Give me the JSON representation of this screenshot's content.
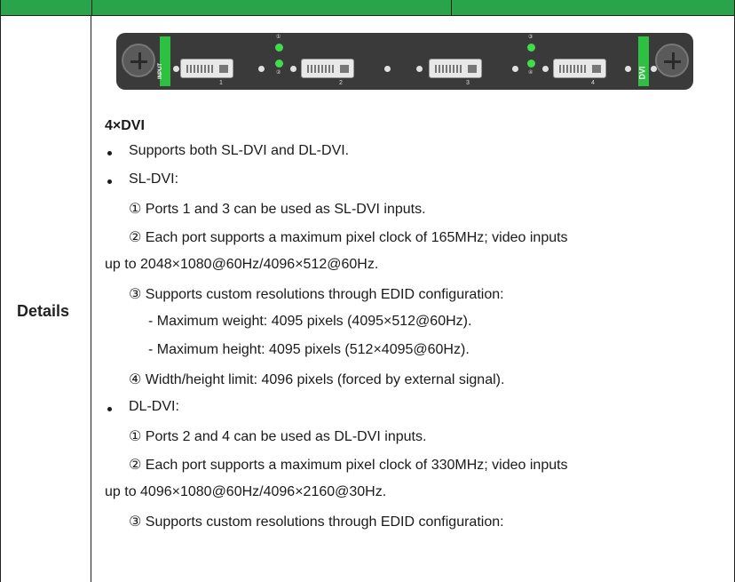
{
  "row_label": "Details",
  "panel": {
    "left_strip": "INPUT",
    "right_strip": "DVI",
    "port_numbers": [
      "1",
      "2",
      "3",
      "4"
    ],
    "led_labels": [
      "①",
      "②",
      "③",
      "④"
    ]
  },
  "heading": "4×DVI",
  "lines": {
    "b1": "Supports both SL-DVI and DL-DVI.",
    "b2": "SL-DVI:",
    "sl1": "① Ports 1 and 3 can be used as SL-DVI inputs.",
    "sl2": "② Each port supports a maximum pixel clock of 165MHz; video inputs",
    "sl2b": "up to 2048×1080@60Hz/4096×512@60Hz.",
    "sl3": "③ Supports custom resolutions through EDID configuration:",
    "sl3a": "- Maximum weight: 4095 pixels (4095×512@60Hz).",
    "sl3b": "- Maximum height: 4095 pixels (512×4095@60Hz).",
    "sl4": "④ Width/height limit: 4096 pixels (forced by external signal).",
    "b3": "DL-DVI:",
    "dl1": "① Ports 2 and 4 can be used as DL-DVI inputs.",
    "dl2": "② Each port supports a maximum pixel clock of 330MHz; video inputs",
    "dl2b": "up to 4096×1080@60Hz/4096×2160@30Hz.",
    "dl3": "③ Supports custom resolutions through EDID configuration:"
  }
}
